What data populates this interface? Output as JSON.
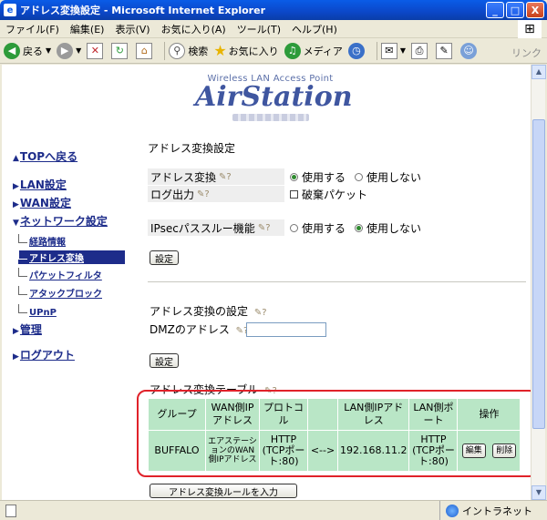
{
  "window": {
    "title": "アドレス変換設定 - Microsoft Internet Explorer",
    "buttons": {
      "minimize": "_",
      "maximize": "□",
      "close": "X"
    }
  },
  "menu": [
    "ファイル(F)",
    "編集(E)",
    "表示(V)",
    "お気に入り(A)",
    "ツール(T)",
    "ヘルプ(H)"
  ],
  "toolbar": {
    "back": "戻る",
    "search": "検索",
    "favorites": "お気に入り",
    "media": "メディア",
    "links": "リンク"
  },
  "logo": {
    "tagline": "Wireless LAN Access Point",
    "brand": "AirStation"
  },
  "sidebar": {
    "top": "TOPへ戻る",
    "lan": "LAN設定",
    "wan": "WAN設定",
    "network": "ネットワーク設定",
    "sub": [
      "経路情報",
      "アドレス変換",
      "パケットフィルタ",
      "アタックブロック",
      "UPnP"
    ],
    "admin": "管理",
    "logout": "ログアウト"
  },
  "nat_settings": {
    "heading": "アドレス変換設定",
    "address_translation": {
      "label": "アドレス変換",
      "opt_on": "使用する",
      "opt_off": "使用しない",
      "selected": "on"
    },
    "log_output": {
      "label": "ログ出力",
      "option": "破棄パケット",
      "checked": false
    },
    "ipsec": {
      "label": "IPsecパススルー機能",
      "opt_on": "使用する",
      "opt_off": "使用しない",
      "selected": "off"
    },
    "apply": "設定"
  },
  "dmz": {
    "heading": "アドレス変換の設定",
    "label": "DMZのアドレス",
    "value": "",
    "apply": "設定"
  },
  "nat_table": {
    "heading": "アドレス変換テーブル",
    "headers": [
      "グループ",
      "WAN側IPアドレス",
      "プロトコル",
      "",
      "LAN側IPアドレス",
      "LAN側ポート",
      "操作"
    ],
    "rows": [
      {
        "group": "BUFFALO",
        "wan_ip": "エアステーションのWAN側IPアドレス",
        "protocol": "HTTP (TCPポート:80)",
        "arrow": "<-->",
        "lan_ip": "192.168.11.2",
        "lan_port": "HTTP (TCPポート:80)",
        "edit": "編集",
        "delete": "削除"
      }
    ],
    "add_rule": "アドレス変換ルールを入力"
  },
  "status": {
    "zone": "イントラネット"
  }
}
